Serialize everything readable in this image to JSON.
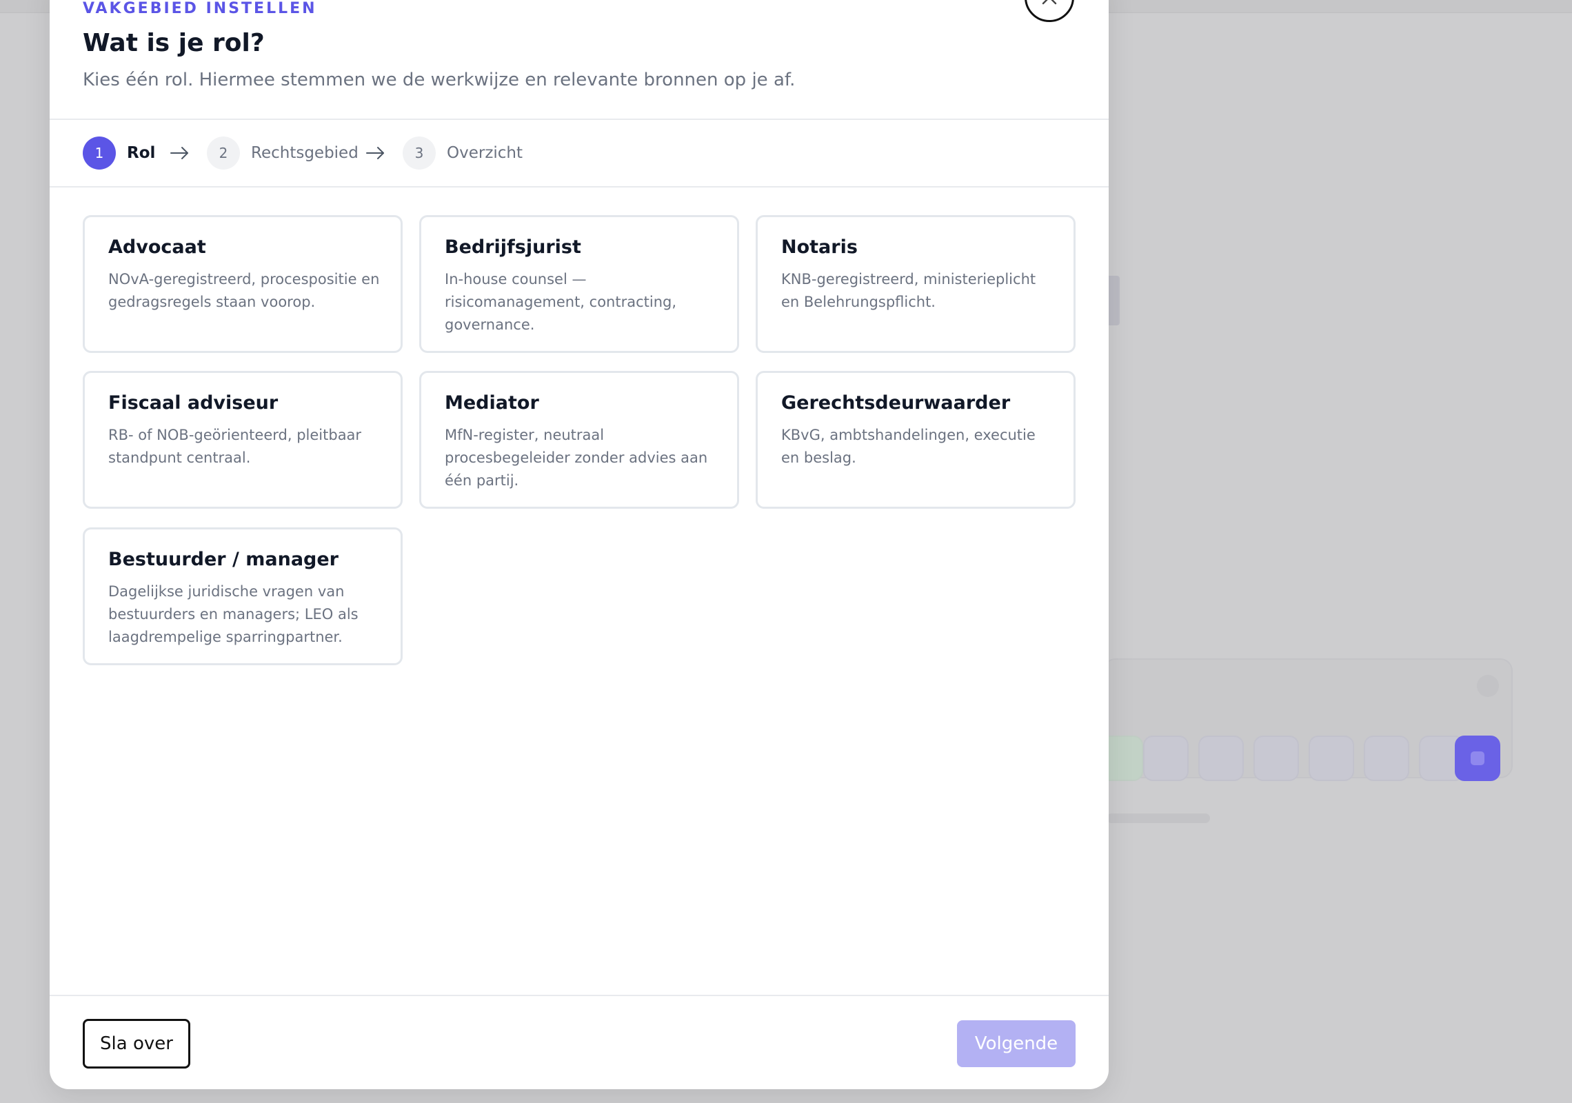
{
  "modal": {
    "eyebrow": "VAKGEBIED INSTELLEN",
    "title": "Wat is je rol?",
    "subtitle": "Kies één rol. Hiermee stemmen we de werkwijze en relevante bronnen op je af."
  },
  "stepper": {
    "steps": [
      {
        "number": "1",
        "label": "Rol",
        "state": "active"
      },
      {
        "number": "2",
        "label": "Rechtsgebied",
        "state": "idle"
      },
      {
        "number": "3",
        "label": "Overzicht",
        "state": "idle"
      }
    ]
  },
  "roles": [
    {
      "title": "Advocaat",
      "description": "NOvA-geregistreerd, procespositie en gedragsregels staan voorop."
    },
    {
      "title": "Bedrijfsjurist",
      "description": "In-house counsel — risicomanagement, contracting, governance."
    },
    {
      "title": "Notaris",
      "description": "KNB-geregistreerd, ministerieplicht en Belehrungspflicht."
    },
    {
      "title": "Fiscaal adviseur",
      "description": "RB- of NOB-geörienteerd, pleitbaar standpunt centraal."
    },
    {
      "title": "Mediator",
      "description": "MfN-register, neutraal procesbegeleider zonder advies aan één partij."
    },
    {
      "title": "Gerechtsdeurwaarder",
      "description": "KBvG, ambtshandelingen, executie en beslag."
    },
    {
      "title": "Bestuurder / manager",
      "description": "Dagelijkse juridische vragen van bestuurders en managers; LEO als laagdrempelige sparringpartner."
    }
  ],
  "footer": {
    "skip_label": "Sla over",
    "next_label": "Volgende"
  },
  "colors": {
    "accent": "#5b55e6",
    "accent_disabled": "#b3b1f3",
    "card_border": "#e3e7ec",
    "overlay": "#cdcdcf"
  },
  "icons": {
    "close": "close-icon",
    "step_arrow": "arrow-right-icon"
  }
}
